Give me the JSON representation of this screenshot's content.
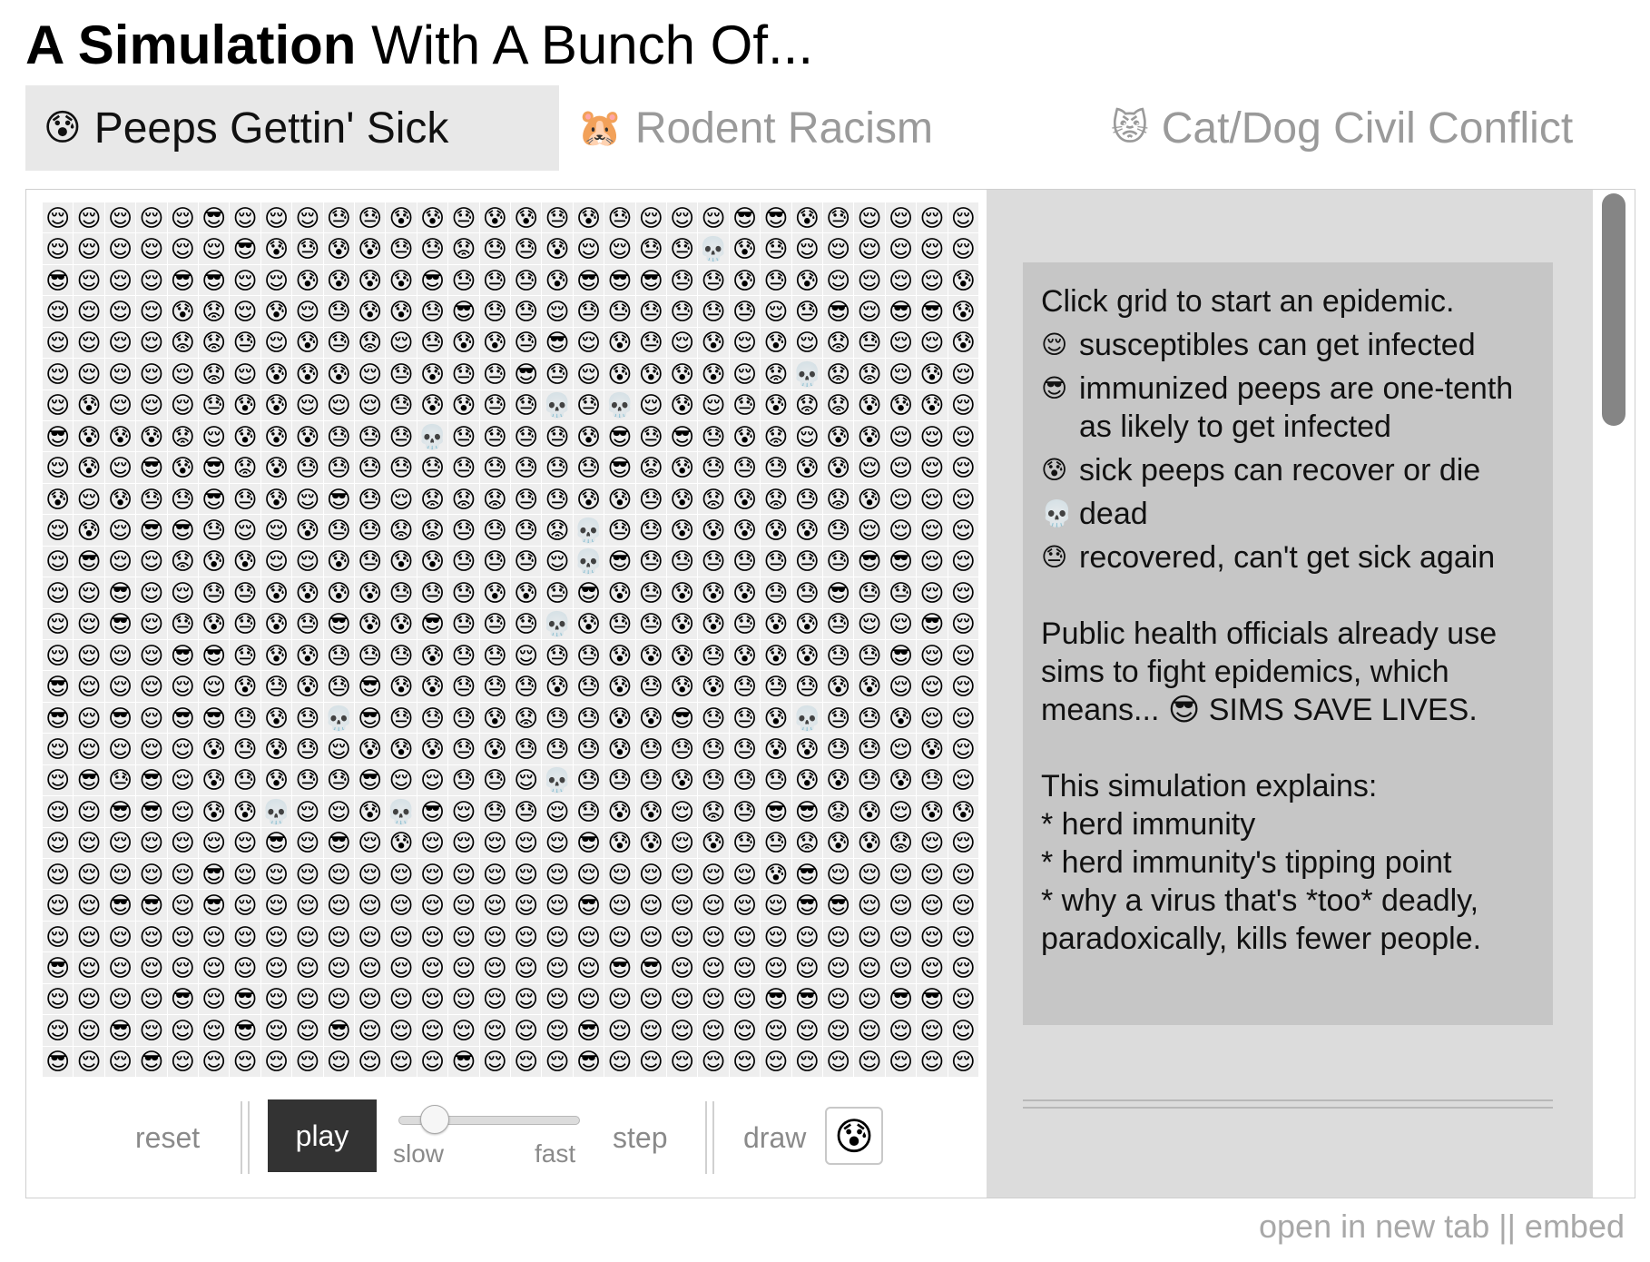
{
  "header": {
    "title_bold": "A Simulation",
    "title_rest": " With A Bunch Of..."
  },
  "tabs": [
    {
      "icon": "😰",
      "label": "Peeps Gettin' Sick",
      "active": true
    },
    {
      "icon": "🐹",
      "label": "Rodent Racism",
      "active": false
    },
    {
      "icon": "😾",
      "label": "Cat/Dog Civil Conflict",
      "active": false
    }
  ],
  "grid": {
    "columns": 30,
    "rows": 28,
    "legend_keys": {
      "S": "😌",
      "I": "😎",
      "K": "😰",
      "R": "😓",
      "F": "😟",
      "D": "💀"
    },
    "cells": [
      "SSSSSISSSRRKKRKKRKRSSSIIKRSSSS",
      "SSSSSSIKRKKRRFRRKSSRRDKRSSSSSS",
      "ISSSIISSKKKKIRRRKIIIRRKRKSSSSK",
      "SSSSKFSKSRKKRIRRSRRRRRRSRISIIK",
      "SSSSFFRSKRFSRKKRISKRSKSKSFRSSK",
      "SSSSSFSKKKSRKRRIRSKKKKSFDFFSKS",
      "SKSSSRKKSSSRKKRRDRDSKSRKFFKKKS",
      "IKKKFSKKKRRRDRRRRKIRIRKFSKKSSS",
      "SKSIKIFKRRRRRRRRRRIFKRRRKKSSSS",
      "KSKRRIRKSIRSFFFRRKKRKFKFRFKSSS",
      "SKSIIRSSKRRFFRRRFDRRKKKKKRSSSS",
      "SISSFKKSSKRKKRRRSDIRRRRRRRIISS",
      "SSISSRRKKKKRRRKKRIKRKKKRRIRRSS",
      "SSISRKRKRIKKIRRRDKRRKKRKKRSSIS",
      "SSSSIIRKKRRRKRRSRRKKKRKKKRRISS",
      "ISSSSSKRKRIKKRRRKRKRKKRRRKKSSS",
      "ISISIIRKRDIRRRKFRRKKIRRKDRRKSS",
      "SSSSSKRKRSKKKRKRRRKRRRRKKRRSKS",
      "SIRISKRKRRISSRRSDRRRKRRRKKRKRS",
      "SSIISKKDSSKDISRRSRKKSFRIIFKSKK",
      "SSSSSSSISISKSSSSSIKKSKRRFKKFSS",
      "SSSSSISSSSSSSSSSSSSSSSSKISSSSS",
      "SSIISISSSSSSSSSSSISSSSSSIISSSS",
      "SSSSSSSSSSSSSSSSSSSSSSSSSSSSSS",
      "ISSSSSSSSSSSSSSSSSIISSSSSSSSSS",
      "SSSSISISSSSSSSSSSSSSSSSIISSIIS",
      "SSISSSISSISSSSSSSISSSSSSSSSSSS",
      "ISSISSSSSSSSSISSSISSSSSSSSSSSS"
    ]
  },
  "controls": {
    "reset_label": "reset",
    "play_label": "play",
    "slider_min_label": "slow",
    "slider_max_label": "fast",
    "slider_value": 0.3,
    "step_label": "step",
    "draw_label": "draw",
    "draw_icon": "😰"
  },
  "info": {
    "intro": "Click grid to start an epidemic.",
    "legend": [
      {
        "icon": "😌",
        "text": "susceptibles can get infected"
      },
      {
        "icon": "😎",
        "text": "immunized peeps are one-tenth as likely to get infected"
      },
      {
        "icon": "😰",
        "text": "sick peeps can recover or die"
      },
      {
        "icon": "💀",
        "text": "dead"
      },
      {
        "icon": "😓",
        "text": "recovered, can't get sick again"
      }
    ],
    "public_health_1": "Public health officials already use sims to fight epidemics, which",
    "public_health_2": "means... 😎  SIMS SAVE LIVES.",
    "explains_heading": "This simulation explains:",
    "explains_items": [
      "* herd immunity",
      "* herd immunity's tipping point",
      "* why a virus that's *too* deadly,",
      "paradoxically, kills fewer people."
    ]
  },
  "footer": {
    "text": "open in new tab || embed"
  },
  "colors": {
    "active_tab_bg": "#e8e8e8",
    "inactive_tab_text": "#9a9a9a",
    "play_bg": "#333333",
    "side_panel_bg": "#dcdcdc",
    "info_box_bg": "#c6c6c6",
    "scroll_thumb": "#858585"
  }
}
